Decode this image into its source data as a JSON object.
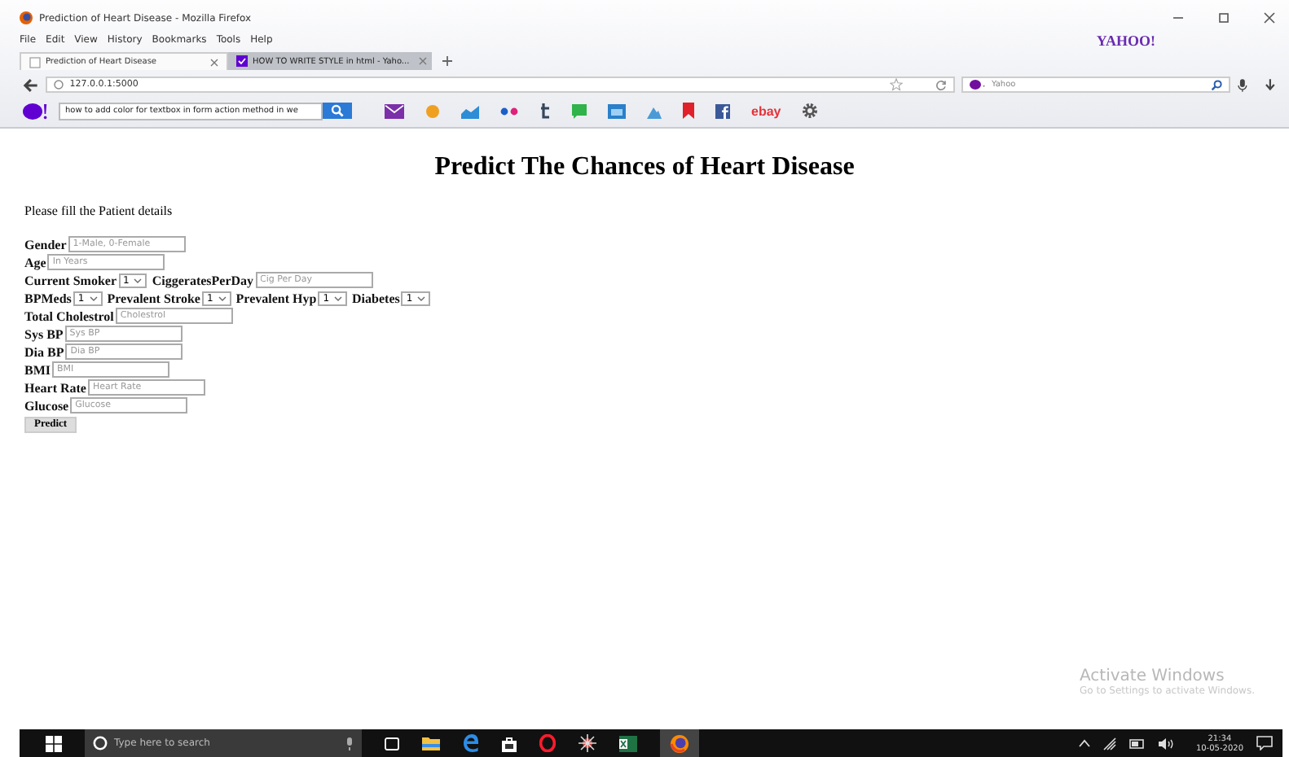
{
  "browser": {
    "title": "Prediction of Heart Disease - Mozilla Firefox",
    "menu": [
      "File",
      "Edit",
      "View",
      "History",
      "Bookmarks",
      "Tools",
      "Help"
    ],
    "tabs": [
      {
        "label": "Prediction of Heart Disease",
        "selected": true
      },
      {
        "label": "HOW TO WRITE STYLE in html - Yaho...",
        "selected": false
      }
    ],
    "brand": "YAHOO!",
    "url": "127.0.0.1:5000",
    "search_placeholder": "Yahoo",
    "toolbar_search": "how to add color for textbox in form action method in we",
    "ebay": "ebay"
  },
  "page": {
    "heading": "Predict The Chances of Heart Disease",
    "intro": "Please fill the Patient details",
    "rows": [
      [
        {
          "label": "Gender",
          "kind": "input",
          "placeholder": "1-Male, 0-Female"
        }
      ],
      [
        {
          "label": "Age",
          "kind": "input",
          "placeholder": "In Years"
        }
      ],
      [
        {
          "label": "Current Smoker",
          "kind": "select",
          "value": "1"
        },
        {
          "label": "CiggeratesPerDay",
          "kind": "input",
          "placeholder": "Cig Per Day"
        }
      ],
      [
        {
          "label": "BPMeds",
          "kind": "select",
          "value": "1"
        },
        {
          "label": "Prevalent Stroke",
          "kind": "select",
          "value": "1"
        },
        {
          "label": "Prevalent Hyp",
          "kind": "select",
          "value": "1"
        },
        {
          "label": "Diabetes",
          "kind": "select",
          "value": "1"
        }
      ],
      [
        {
          "label": "Total Cholestrol",
          "kind": "input",
          "placeholder": "Cholestrol"
        }
      ],
      [
        {
          "label": "Sys BP",
          "kind": "input",
          "placeholder": "Sys BP"
        }
      ],
      [
        {
          "label": "Dia BP",
          "kind": "input",
          "placeholder": "Dia BP"
        }
      ],
      [
        {
          "label": "BMI",
          "kind": "input",
          "placeholder": "BMI"
        }
      ],
      [
        {
          "label": "Heart Rate",
          "kind": "input",
          "placeholder": "Heart Rate"
        }
      ],
      [
        {
          "label": "Glucose",
          "kind": "input",
          "placeholder": "Glucose"
        }
      ]
    ],
    "button": "Predict"
  },
  "activation": {
    "title": "Activate Windows",
    "subtitle": "Go to Settings to activate Windows."
  },
  "taskbar": {
    "search_placeholder": "Type here to search",
    "time": "21:34",
    "date": "10-05-2020"
  }
}
